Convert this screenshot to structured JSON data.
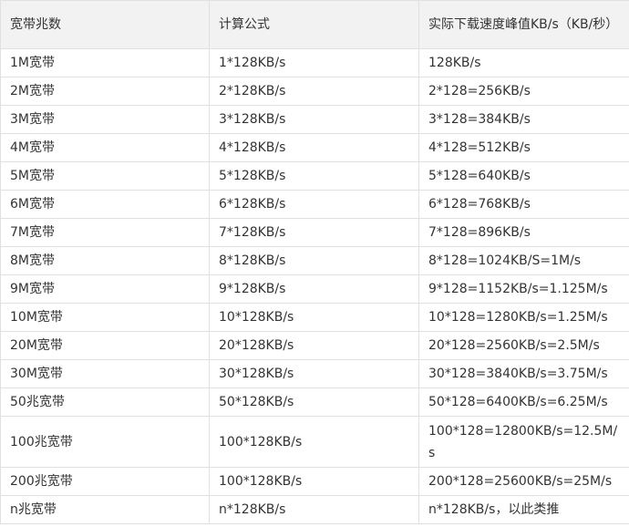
{
  "table": {
    "headers": [
      "宽带兆数",
      "计算公式",
      "实际下载速度峰值KB/s（KB/秒）"
    ],
    "rows": [
      [
        "1M宽带",
        "1*128KB/s",
        "128KB/s"
      ],
      [
        "2M宽带",
        "2*128KB/s",
        "2*128=256KB/s"
      ],
      [
        "3M宽带",
        "3*128KB/s",
        "3*128=384KB/s"
      ],
      [
        "4M宽带",
        "4*128KB/s",
        "4*128=512KB/s"
      ],
      [
        "5M宽带",
        "5*128KB/s",
        "5*128=640KB/s"
      ],
      [
        "6M宽带",
        "6*128KB/s",
        "6*128=768KB/s"
      ],
      [
        "7M宽带",
        "7*128KB/s",
        "7*128=896KB/s"
      ],
      [
        "8M宽带",
        "8*128KB/s",
        "8*128=1024KB/S=1M/s"
      ],
      [
        "9M宽带",
        "9*128KB/s",
        "9*128=1152KB/s=1.125M/s"
      ],
      [
        "10M宽带",
        "10*128KB/s",
        "10*128=1280KB/s=1.25M/s"
      ],
      [
        "20M宽带",
        "20*128KB/s",
        "20*128=2560KB/s=2.5M/s"
      ],
      [
        "30M宽带",
        "30*128KB/s",
        "30*128=3840KB/s=3.75M/s"
      ],
      [
        "50兆宽带",
        "50*128KB/s",
        "50*128=6400KB/s=6.25M/s"
      ],
      [
        "100兆宽带",
        "100*128KB/s",
        "100*128=12800KB/s=12.5M/s"
      ],
      [
        "200兆宽带",
        "100*128KB/s",
        "200*128=25600KB/s=25M/s"
      ],
      [
        "n兆宽带",
        "n*128KB/s",
        "n*128KB/s，以此类推"
      ]
    ]
  }
}
